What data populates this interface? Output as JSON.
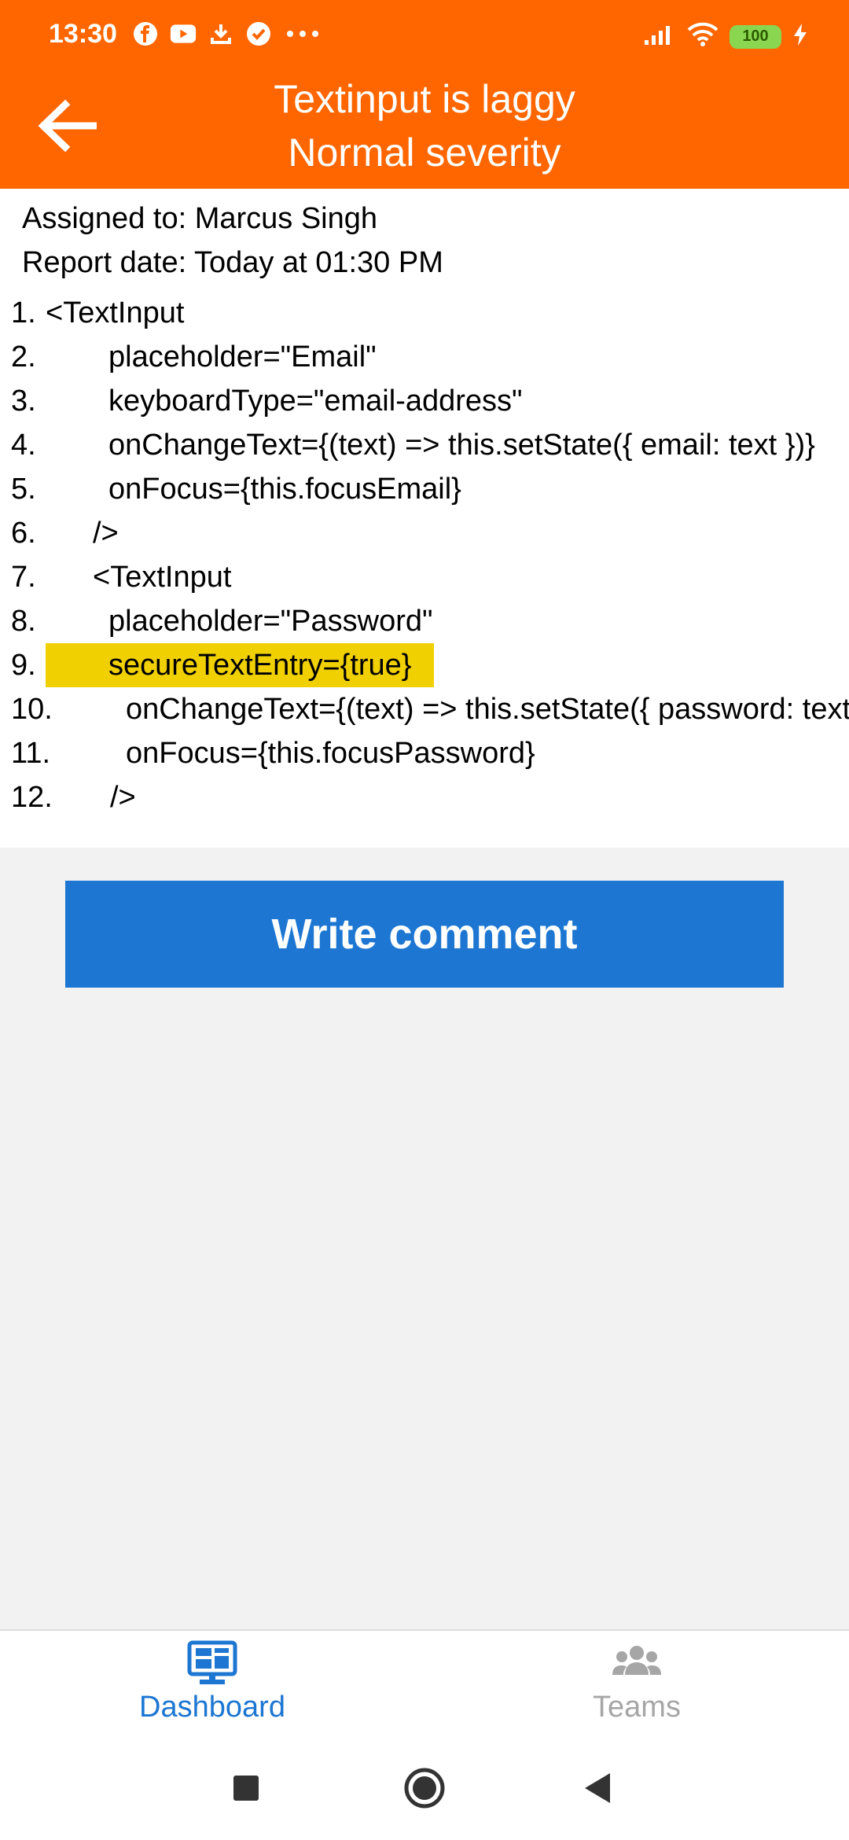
{
  "status": {
    "time": "13:30",
    "battery": "100"
  },
  "header": {
    "title": "Textinput is laggy",
    "subtitle": "Normal severity"
  },
  "report": {
    "assigned": "Assigned to: Marcus Singh",
    "date": "Report date: Today at 01:30 PM"
  },
  "code": [
    {
      "num": "1.",
      "text": "<TextInput"
    },
    {
      "num": "2.",
      "text": "placeholder=\"Email\""
    },
    {
      "num": "3.",
      "text": "keyboardType=\"email-address\""
    },
    {
      "num": "4.",
      "text": "onChangeText={(text) => this.setState({ email: text })}"
    },
    {
      "num": "5.",
      "text": "onFocus={this.focusEmail}"
    },
    {
      "num": "6.",
      "text": "/>"
    },
    {
      "num": "7.",
      "text": "<TextInput"
    },
    {
      "num": "8.",
      "text": "placeholder=\"Password\""
    },
    {
      "num": "9.",
      "text": "secureTextEntry={true}"
    },
    {
      "num": "10.",
      "text": "onChangeText={(text) => this.setState({ password: text })}"
    },
    {
      "num": "11.",
      "text": "onFocus={this.focusPassword}"
    },
    {
      "num": "12.",
      "text": "/>"
    }
  ],
  "actions": {
    "write_comment": "Write comment"
  },
  "bottom_nav": {
    "dashboard": "Dashboard",
    "teams": "Teams"
  },
  "colors": {
    "header": "#ff6600",
    "primary": "#1c76d2",
    "highlight": "#f0d000"
  }
}
